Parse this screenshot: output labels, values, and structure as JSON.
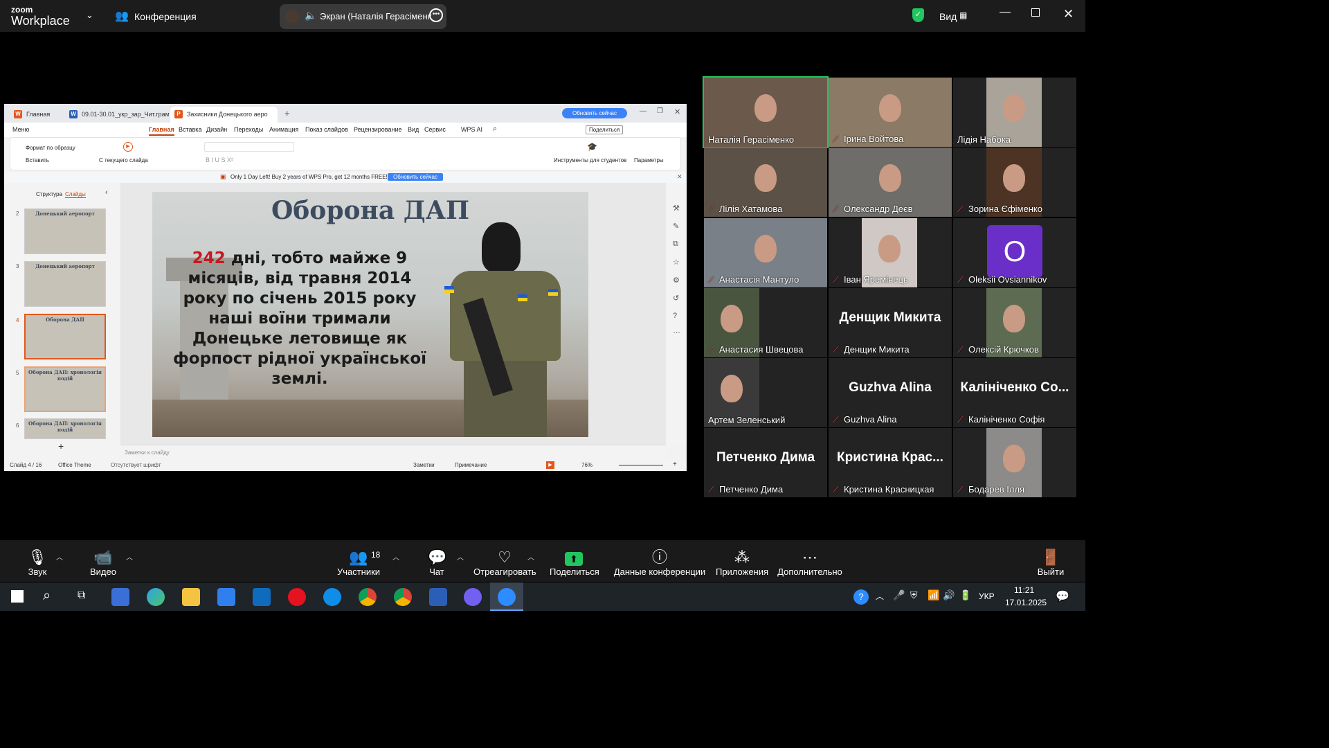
{
  "zoom": {
    "brand_top": "zoom",
    "brand_bottom": "Workplace",
    "meeting_label": "Конференция",
    "screen_label": "Экран (Наталія Герасіменк",
    "view_label": "Вид"
  },
  "wps": {
    "tabs": [
      "Главная",
      "09.01-30.01_укр_зар_Чит.грамоті",
      "Захисники Донецького аеро"
    ],
    "upgrade_button": "Обновить сейчас",
    "menu": [
      "Меню",
      "Главная",
      "Вставка",
      "Дизайн",
      "Переходы",
      "Анимация",
      "Показ слайдов",
      "Рецензирование",
      "Вид",
      "Сервис",
      "WPS AI"
    ],
    "share_button": "Поделиться",
    "ribbon": {
      "format_painter": "Формат по образцу",
      "paste": "Вставить",
      "from_current": "С текущего слайда",
      "student_tools": "Инструменты для студентов",
      "params": "Параметры"
    },
    "promo_text": "Only 1 Day Left! Buy 2 years of WPS Pro, get 12 months FREE!",
    "promo_button": "Обновить сейчас",
    "pane_tabs": [
      "Структура",
      "Слайды"
    ],
    "thumbnails": [
      {
        "num": "2",
        "title": "Донецький аеропорт"
      },
      {
        "num": "3",
        "title": "Донецький аеропорт"
      },
      {
        "num": "4",
        "title": "Оборона ДАП"
      },
      {
        "num": "5",
        "title": "Оборона ДАП: хронологія подій"
      },
      {
        "num": "6",
        "title": "Оборона ДАП: хронологія подій"
      }
    ],
    "slide": {
      "title": "Оборона ДАП",
      "highlight": "242",
      "body": " дні, тобто майже 9 місяців, від травня 2014 року по січень 2015 року наші воїни тримали Донецьке летовище як форпост рідної української землі."
    },
    "notes_placeholder": "Заметки к слайду",
    "status": {
      "slide_counter": "Слайд 4 / 16",
      "theme": "Office Theme",
      "missing_font": "Отсутствует шрифт",
      "notes": "Заметки",
      "comment": "Примечание",
      "zoom": "76%"
    }
  },
  "participants": [
    {
      "name": "Наталія Герасіменко",
      "muted": false,
      "type": "video",
      "bg": "#6b5a4c"
    },
    {
      "name": "Ірина Войтова",
      "muted": true,
      "type": "video",
      "bg": "#8a7a66"
    },
    {
      "name": "Лідія Набока",
      "muted": false,
      "type": "video",
      "bg": "#a9a39a"
    },
    {
      "name": "Лілія Хатамова",
      "muted": true,
      "type": "video",
      "bg": "#5b5147"
    },
    {
      "name": "Олександр Деєв",
      "muted": true,
      "type": "video",
      "bg": "#6e6d6a"
    },
    {
      "name": "Зорина Єфіменко",
      "muted": true,
      "type": "video",
      "bg": "#4d3324"
    },
    {
      "name": "Анастасія Мантуло",
      "muted": true,
      "type": "video",
      "bg": "#7a8088"
    },
    {
      "name": "Іван Яремінець",
      "muted": true,
      "type": "video",
      "bg": "#cfc8c4"
    },
    {
      "name": "Oleksii Ovsiannikov",
      "muted": true,
      "type": "avatar",
      "initial": "O"
    },
    {
      "name": "Анастасия Швецова",
      "muted": true,
      "type": "video",
      "bg": "#4a5540"
    },
    {
      "name": "Денщик Микита",
      "muted": true,
      "type": "text",
      "display": "Денщик Микита"
    },
    {
      "name": "Олексій Крючков",
      "muted": true,
      "type": "video",
      "bg": "#5d6b52"
    },
    {
      "name": "Артем Зеленський",
      "muted": false,
      "type": "video",
      "bg": "#3a3a3a"
    },
    {
      "name": "Guzhva Alina",
      "muted": true,
      "type": "text",
      "display": "Guzhva Alina"
    },
    {
      "name": "Калініченко Софія",
      "muted": true,
      "type": "text",
      "display": "Калініченко Со..."
    },
    {
      "name": "Петченко Дима",
      "muted": true,
      "type": "text",
      "display": "Петченко Дима"
    },
    {
      "name": "Кристина Красницкая",
      "muted": true,
      "type": "text",
      "display": "Кристина Крас..."
    },
    {
      "name": "Бодарев Ілля",
      "muted": true,
      "type": "video",
      "bg": "#8d8a8a"
    }
  ],
  "toolbar": {
    "audio": "Звук",
    "video": "Видео",
    "participants": "Участники",
    "participants_count": "18",
    "chat": "Чат",
    "react": "Отреагировать",
    "share": "Поделиться",
    "info": "Данные конференции",
    "apps": "Приложения",
    "more": "Дополнительно",
    "leave": "Выйти"
  },
  "taskbar": {
    "lang": "УКР",
    "time": "11:21",
    "date": "17.01.2025"
  },
  "colors": {
    "accent_green": "#22c55e",
    "mute_red": "#e0454c",
    "wps_orange": "#e3571c",
    "avatar_purple": "#6a2fc9"
  }
}
